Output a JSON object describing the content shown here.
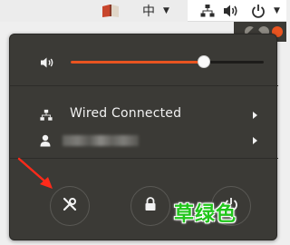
{
  "top_panel": {
    "input_method": "中",
    "icons": {
      "app": "book-icon",
      "network": "network-icon",
      "volume": "volume-icon",
      "power": "power-icon",
      "dropdown": "chevron-down-icon"
    }
  },
  "menu": {
    "volume": {
      "level": 0.69,
      "icon": "speaker-icon"
    },
    "network": {
      "label": "Wired Connected",
      "icon": "network-icon"
    },
    "user": {
      "label": "",
      "icon": "user-icon"
    },
    "actions": [
      {
        "name": "settings",
        "icon": "wrench-screwdriver-icon"
      },
      {
        "name": "lock",
        "icon": "lock-icon"
      },
      {
        "name": "power-off",
        "icon": "power-icon"
      }
    ]
  },
  "annotation": {
    "label": "草绿色",
    "color": "#21c51b",
    "arrow_color": "#ff2a1a"
  },
  "colors": {
    "menu_bg": "#3b3a36",
    "accent": "#e95420"
  }
}
